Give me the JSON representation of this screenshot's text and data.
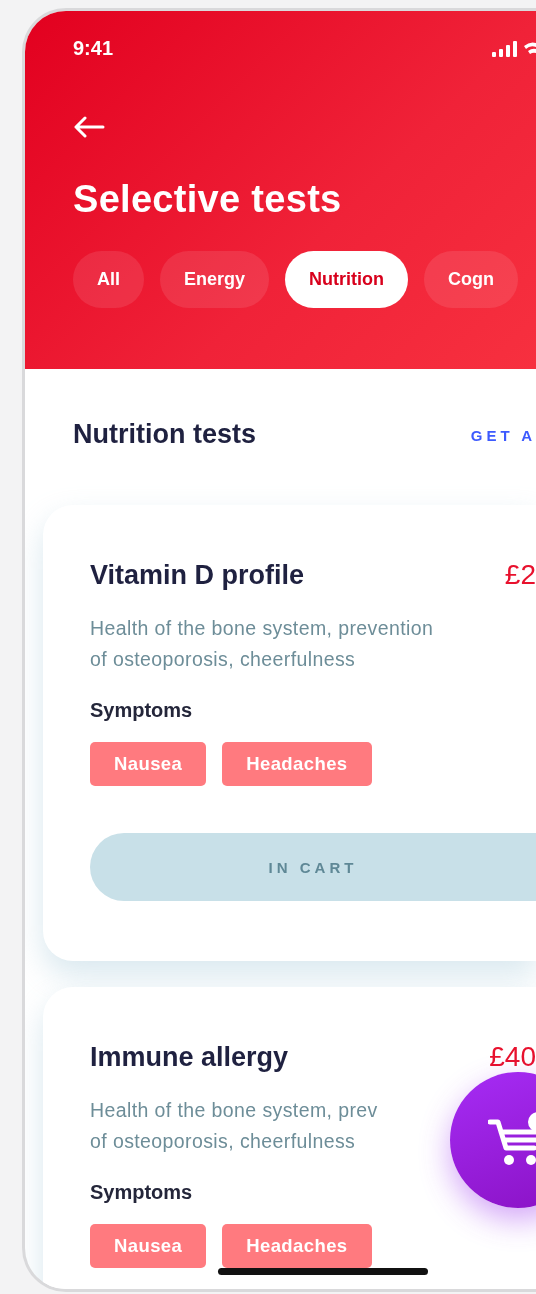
{
  "status_bar": {
    "time": "9:41"
  },
  "header": {
    "title": "Selective tests"
  },
  "filters": [
    {
      "label": "All",
      "selected": false
    },
    {
      "label": "Energy",
      "selected": false
    },
    {
      "label": "Nutrition",
      "selected": true
    },
    {
      "label": "Cogn",
      "selected": false
    }
  ],
  "section": {
    "title": "Nutrition tests",
    "action": "GET A"
  },
  "tests": [
    {
      "name": "Vitamin D profile",
      "price": "£2",
      "description_lines": [
        "Health of the bone system, prevention",
        "of osteoporosis, cheerfulness"
      ],
      "symptoms_label": "Symptoms",
      "symptoms": [
        "Nausea",
        "Headaches"
      ],
      "button": "IN CART"
    },
    {
      "name": "Immune allergy",
      "price": "£40",
      "description_lines": [
        "Health of the bone system, prev",
        "of osteoporosis, cheerfulness"
      ],
      "symptoms_label": "Symptoms",
      "symptoms": [
        "Nausea",
        "Headaches"
      ]
    }
  ]
}
